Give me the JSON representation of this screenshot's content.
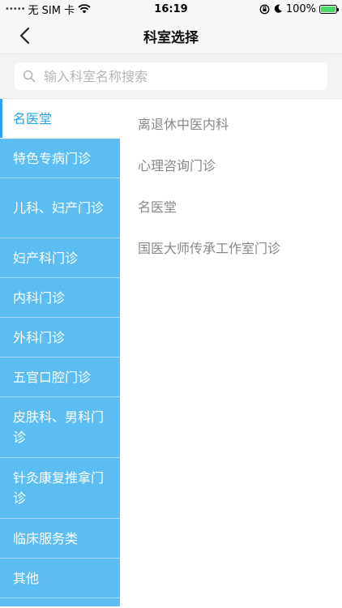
{
  "status_bar": {
    "carrier": "无 SIM 卡",
    "time": "16:19",
    "battery": "100%",
    "icons": [
      "signal-dots-icon",
      "wifi-icon",
      "rotation-lock-icon",
      "moon-icon",
      "battery-charging-icon"
    ]
  },
  "nav": {
    "title": "科室选择",
    "back_icon": "chevron-left-icon"
  },
  "search": {
    "placeholder": "输入科室名称搜索",
    "value": "",
    "icon": "search-icon"
  },
  "categories": [
    {
      "label": "名医堂",
      "selected": true
    },
    {
      "label": "特色专病门诊"
    },
    {
      "label": "儿科、妇产门诊"
    },
    {
      "label": "妇产科门诊"
    },
    {
      "label": "内科门诊"
    },
    {
      "label": "外科门诊"
    },
    {
      "label": "五官口腔门诊"
    },
    {
      "label": "皮肤科、男科门诊"
    },
    {
      "label": "针灸康复推拿门诊"
    },
    {
      "label": "临床服务类"
    },
    {
      "label": "其他"
    }
  ],
  "departments": [
    {
      "label": "离退休中医内科"
    },
    {
      "label": "心理咨询门诊"
    },
    {
      "label": "名医堂"
    },
    {
      "label": "国医大师传承工作室门诊"
    }
  ],
  "colors": {
    "accent": "#5cbdf2",
    "active_text": "#2aa2ea"
  }
}
